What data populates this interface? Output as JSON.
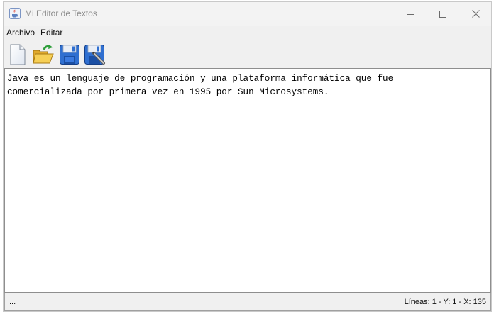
{
  "window": {
    "title": "Mi Editor de Textos",
    "app_icon": "java-cup-icon",
    "controls": [
      "minimize-icon",
      "maximize-icon",
      "close-icon"
    ]
  },
  "menubar": {
    "items": [
      {
        "label": "Archivo"
      },
      {
        "label": "Editar"
      }
    ]
  },
  "toolbar": {
    "buttons": [
      {
        "icon": "new-file-icon"
      },
      {
        "icon": "open-folder-icon"
      },
      {
        "icon": "save-icon"
      },
      {
        "icon": "save-as-icon"
      }
    ]
  },
  "editor": {
    "content": "Java es un lenguaje de programación y una plataforma informática que fue\ncomercializada por primera vez en 1995 por Sun Microsystems."
  },
  "statusbar": {
    "left": "...",
    "right": "Líneas: 1 - Y: 1 - X: 135"
  },
  "colors": {
    "accent_blue": "#1f5fbf",
    "folder_yellow": "#f2c94c",
    "arrow_green": "#2e9e3a"
  }
}
